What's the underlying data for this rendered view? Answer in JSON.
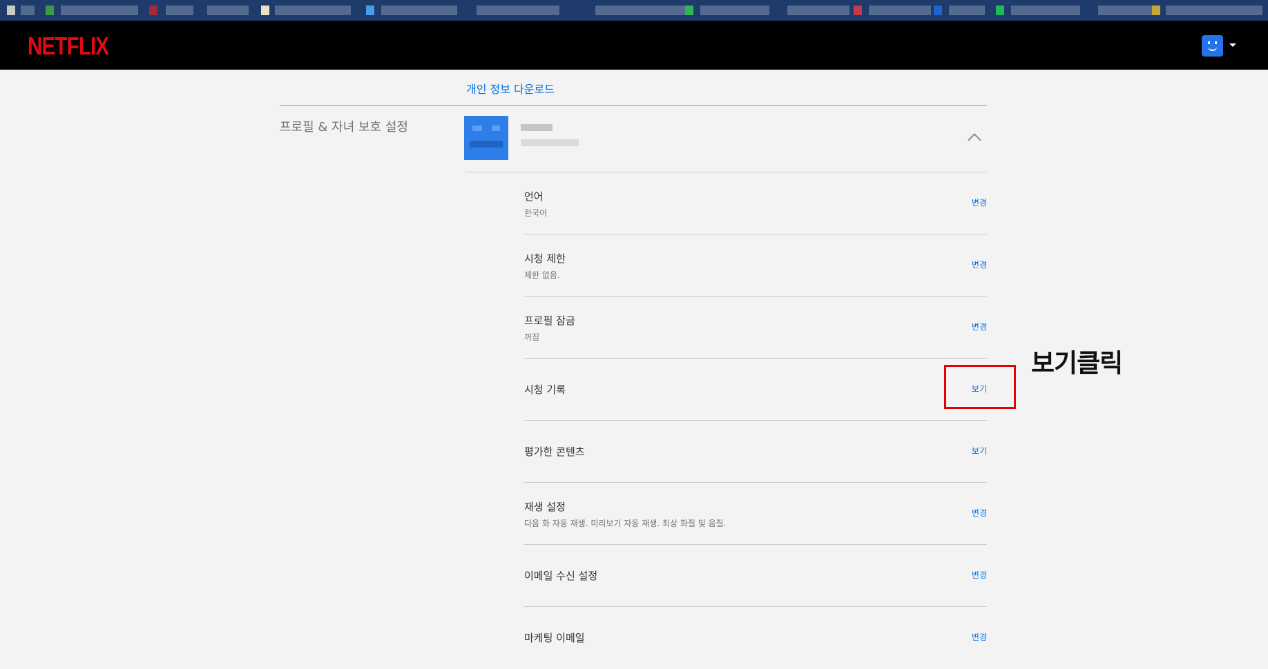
{
  "header": {
    "logo_text": "NETFLIX",
    "brand_color": "#e50914",
    "avatar_color": "#2473e8"
  },
  "account": {
    "download_link": "개인 정보 다운로드"
  },
  "profile_section": {
    "title": "프로필 & 자녀 보호 설정",
    "settings": [
      {
        "title": "언어",
        "desc": "한국어",
        "action": "변경"
      },
      {
        "title": "시청 제한",
        "desc": "제한 없음.",
        "action": "변경"
      },
      {
        "title": "프로필 잠금",
        "desc": "꺼짐",
        "action": "변경"
      },
      {
        "title": "시청 기록",
        "desc": "",
        "action": "보기"
      },
      {
        "title": "평가한 콘텐츠",
        "desc": "",
        "action": "보기"
      },
      {
        "title": "재생 설정",
        "desc": "다음 화 자동 재생. 미리보기 자동 재생. 최상 화질 및 음질.",
        "action": "변경"
      },
      {
        "title": "이메일 수신 설정",
        "desc": "",
        "action": "변경"
      },
      {
        "title": "마케팅 이메일",
        "desc": "",
        "action": "변경"
      }
    ]
  },
  "annotation": {
    "text": "보기클릭",
    "color": "#e60000"
  },
  "colors": {
    "link": "#0073e6",
    "background": "#f3f3f3"
  }
}
